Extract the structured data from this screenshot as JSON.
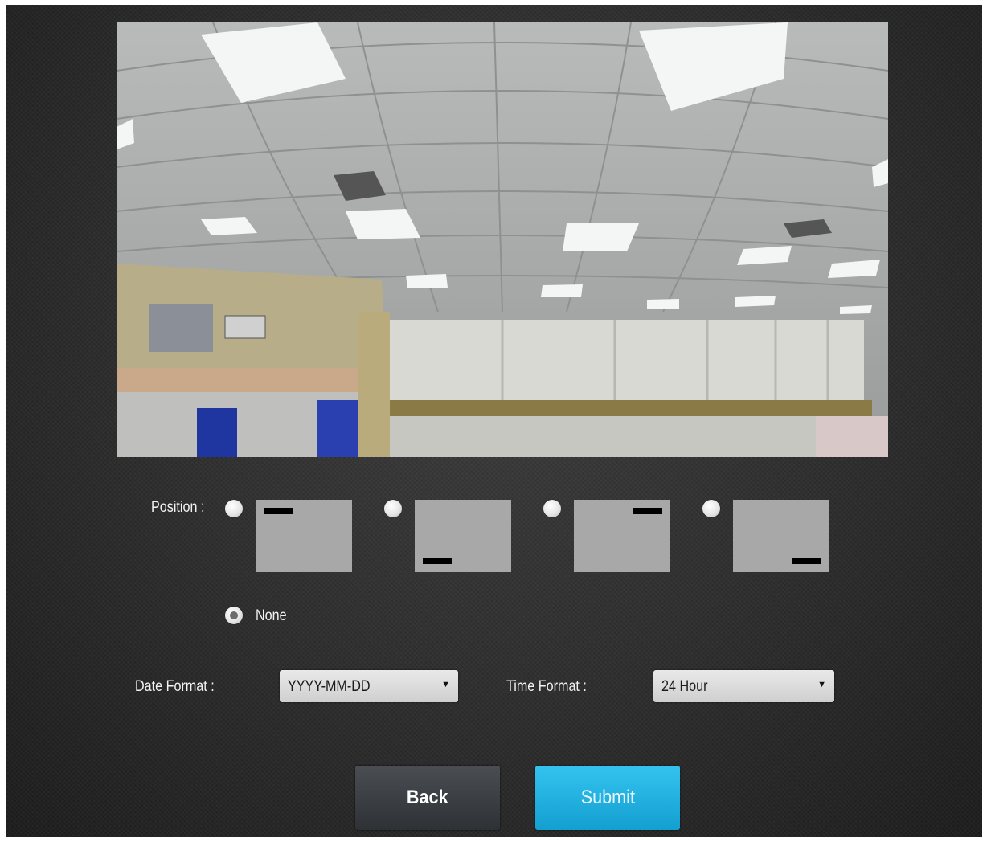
{
  "position": {
    "label": "Position :",
    "options": [
      {
        "id": "top-left",
        "selected": false
      },
      {
        "id": "bottom-left",
        "selected": false
      },
      {
        "id": "top-right",
        "selected": false
      },
      {
        "id": "bottom-right",
        "selected": false
      }
    ],
    "none_label": "None",
    "none_selected": true
  },
  "date_format": {
    "label": "Date Format :",
    "value": "YYYY-MM-DD"
  },
  "time_format": {
    "label": "Time Format :",
    "value": "24 Hour"
  },
  "buttons": {
    "back": "Back",
    "submit": "Submit"
  },
  "colors": {
    "submit": "#1fb0e2",
    "back": "#3d4045",
    "panel": "#2a2a2a"
  },
  "icons": {
    "dropdown": "▼"
  }
}
